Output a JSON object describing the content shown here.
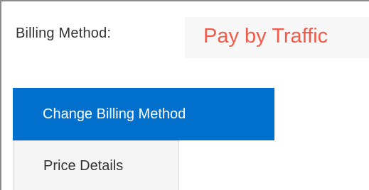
{
  "billing": {
    "label": "Billing Method:",
    "value": "Pay by Traffic",
    "value_color": "#f25b4a"
  },
  "actions": {
    "change_billing_label": "Change Billing Method",
    "price_details_label": "Price Details",
    "primary_color": "#0070cc"
  }
}
